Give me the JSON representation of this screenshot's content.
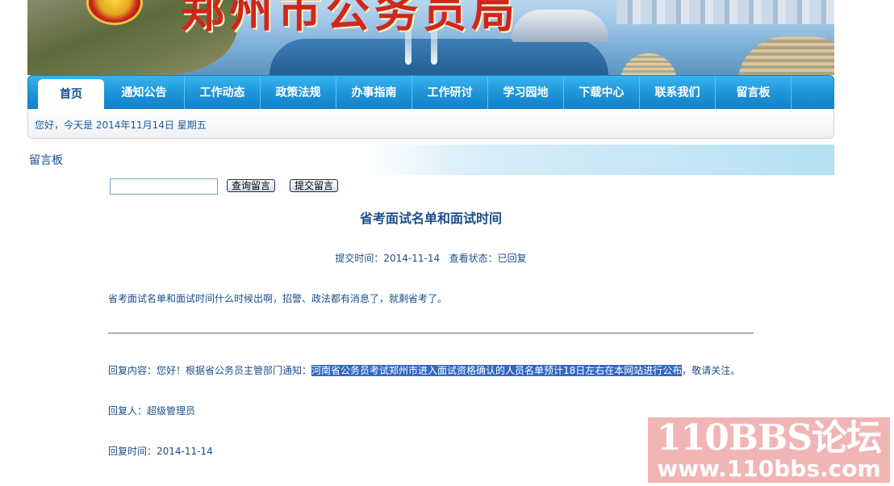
{
  "header": {
    "site_title": "郑州市公务员局"
  },
  "nav": {
    "items": [
      {
        "label": "首页",
        "active": true
      },
      {
        "label": "通知公告"
      },
      {
        "label": "工作动态"
      },
      {
        "label": "政策法规"
      },
      {
        "label": "办事指南"
      },
      {
        "label": "工作研讨"
      },
      {
        "label": "学习园地"
      },
      {
        "label": "下载中心"
      },
      {
        "label": "联系我们"
      },
      {
        "label": "留言板"
      }
    ]
  },
  "date_bar": {
    "text": "您好，今天是 2014年11月14日 星期五"
  },
  "section": {
    "title": "留言板"
  },
  "search": {
    "input_value": "",
    "query_button": "查询留言",
    "submit_button": "提交留言"
  },
  "message": {
    "title": "省考面试名单和面试时间",
    "meta": "提交时间：2014-11-14   查看状态：已回复",
    "question": "省考面试名单和面试时间什么时候出啊，招警、政法都有消息了，就剩省考了。",
    "reply_prefix": "回复内容：您好！根据省公务员主管部门通知：",
    "reply_selected": "河南省公务员考试郑州市进入面试资格确认的人员名单预计18日左右在本网站进行公布",
    "reply_suffix": "，敬请关注。",
    "replier": "回复人：超级管理员",
    "reply_time": "回复时间：2014-11-14"
  },
  "watermark": {
    "line1": "110BBS论坛",
    "line2": "www.110bbs.com"
  }
}
